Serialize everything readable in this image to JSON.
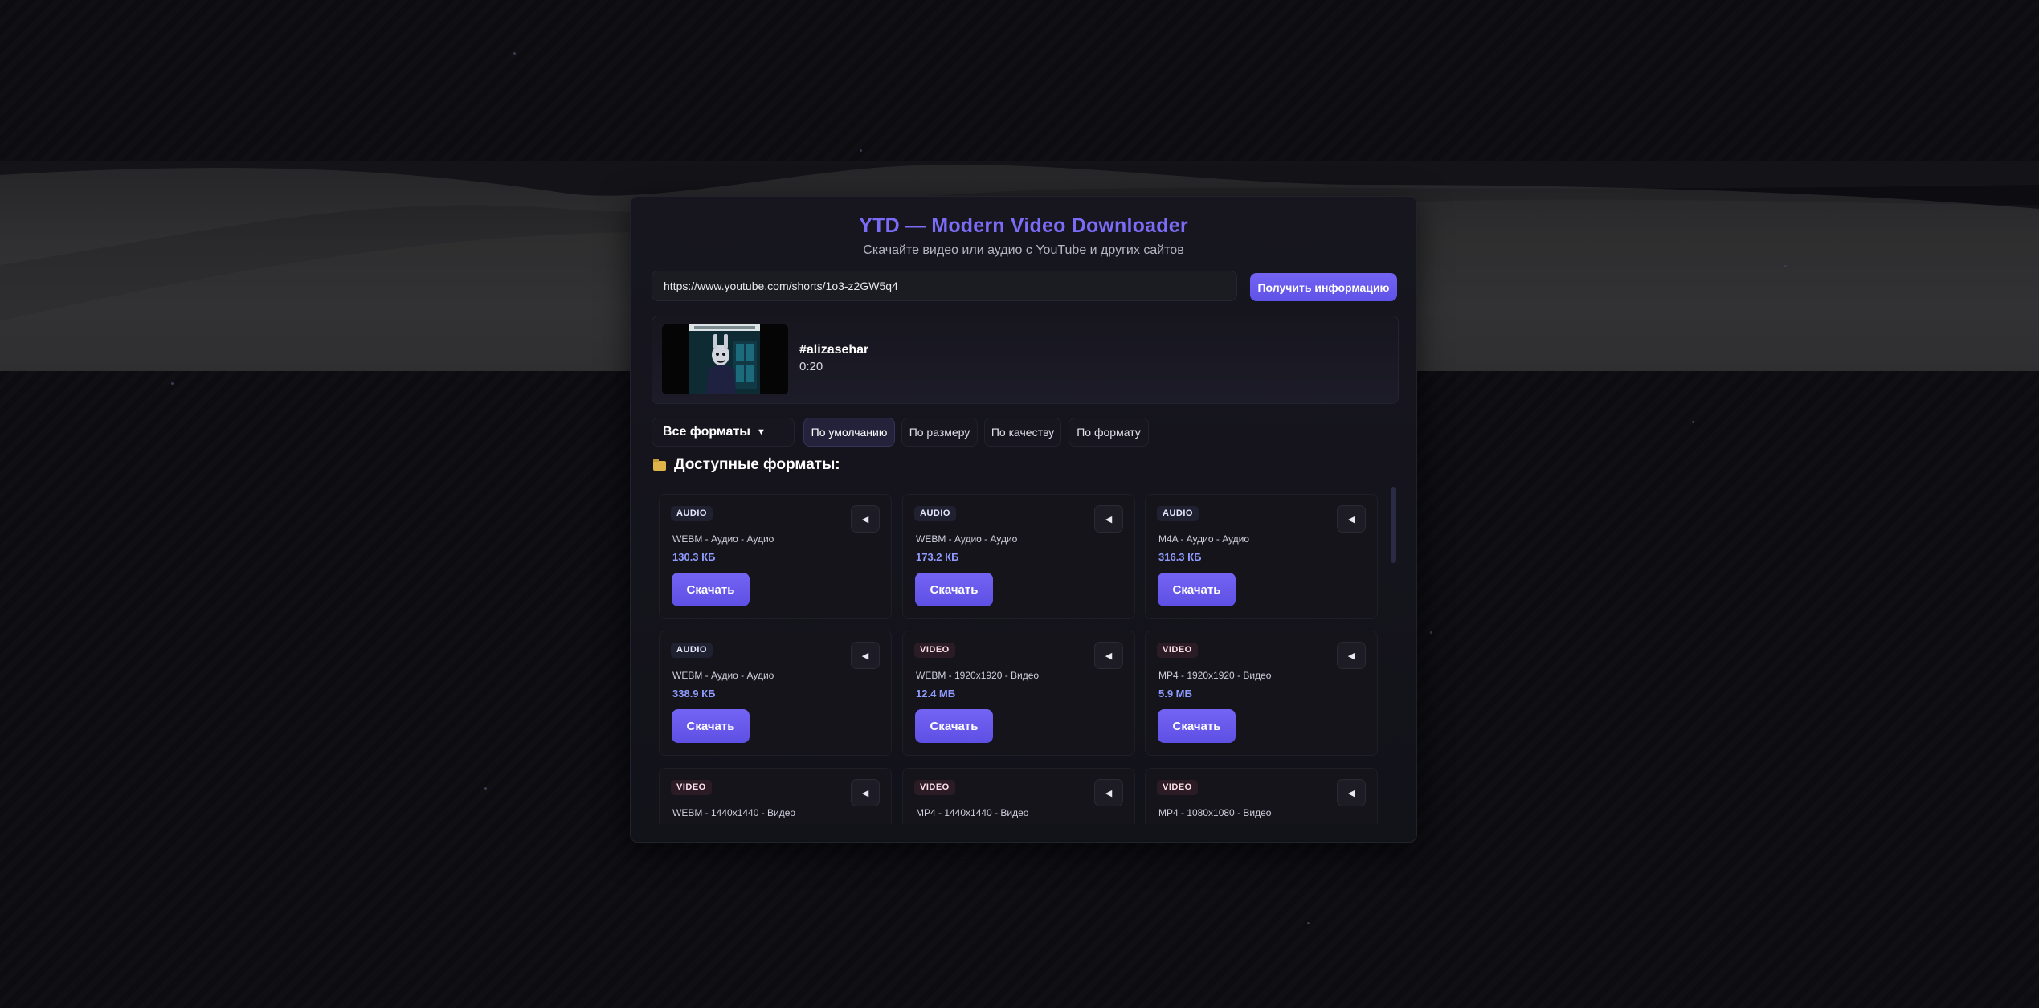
{
  "app": {
    "title": "YTD — Modern Video Downloader",
    "subtitle": "Скачайте видео или аудио с YouTube и других сайтов"
  },
  "url_input": {
    "value": "https://www.youtube.com/shorts/1o3-z2GW5q4"
  },
  "info_button": {
    "label": "Получить информацию"
  },
  "video": {
    "title": "#alizasehar",
    "duration": "0:20"
  },
  "filter": {
    "selected": "Все форматы",
    "caret": "▼"
  },
  "sort_buttons": [
    {
      "label": "По умолчанию",
      "active": true
    },
    {
      "label": "По размеру",
      "active": false
    },
    {
      "label": "По качеству",
      "active": false
    },
    {
      "label": "По формату",
      "active": false
    }
  ],
  "section_title": "Доступные форматы:",
  "formats": [
    {
      "type": "AUDIO",
      "desc": "WEBM - Аудио - Аудио",
      "size": "130.3 КБ",
      "button": "Скачать"
    },
    {
      "type": "AUDIO",
      "desc": "WEBM - Аудио - Аудио",
      "size": "173.2 КБ",
      "button": "Скачать"
    },
    {
      "type": "AUDIO",
      "desc": "M4A - Аудио - Аудио",
      "size": "316.3 КБ",
      "button": "Скачать"
    },
    {
      "type": "AUDIO",
      "desc": "WEBM - Аудио - Аудио",
      "size": "338.9 КБ",
      "button": "Скачать"
    },
    {
      "type": "VIDEO",
      "desc": "WEBM - 1920x1920 - Видео",
      "size": "12.4 МБ",
      "button": "Скачать"
    },
    {
      "type": "VIDEO",
      "desc": "MP4 - 1920x1920 - Видео",
      "size": "5.9 МБ",
      "button": "Скачать"
    },
    {
      "type": "VIDEO",
      "desc": "WEBM - 1440x1440 - Видео",
      "size": "",
      "button": ""
    },
    {
      "type": "VIDEO",
      "desc": "MP4 - 1440x1440 - Видео",
      "size": "",
      "button": ""
    },
    {
      "type": "VIDEO",
      "desc": "MP4 - 1080x1080 - Видео",
      "size": "",
      "button": ""
    }
  ],
  "play_icon": "◀",
  "colors": {
    "accent": "#6f60f2",
    "background": "#0c0c11",
    "panel": "#15141b",
    "size_text": "#8f9bff"
  }
}
